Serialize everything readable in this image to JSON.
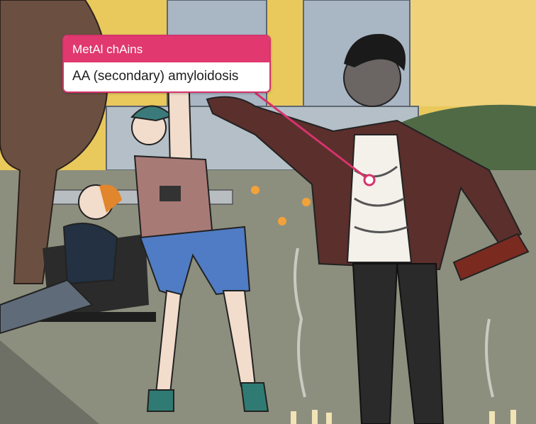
{
  "callout": {
    "title": "MetAl chAins",
    "label": "AA (secondary) amyloidosis"
  },
  "colors": {
    "accent": "#e0386f",
    "sky": "#e8c85a",
    "ground": "#8d8f7e"
  },
  "icons": {
    "pointer_dot": "pointer-dot-icon"
  }
}
